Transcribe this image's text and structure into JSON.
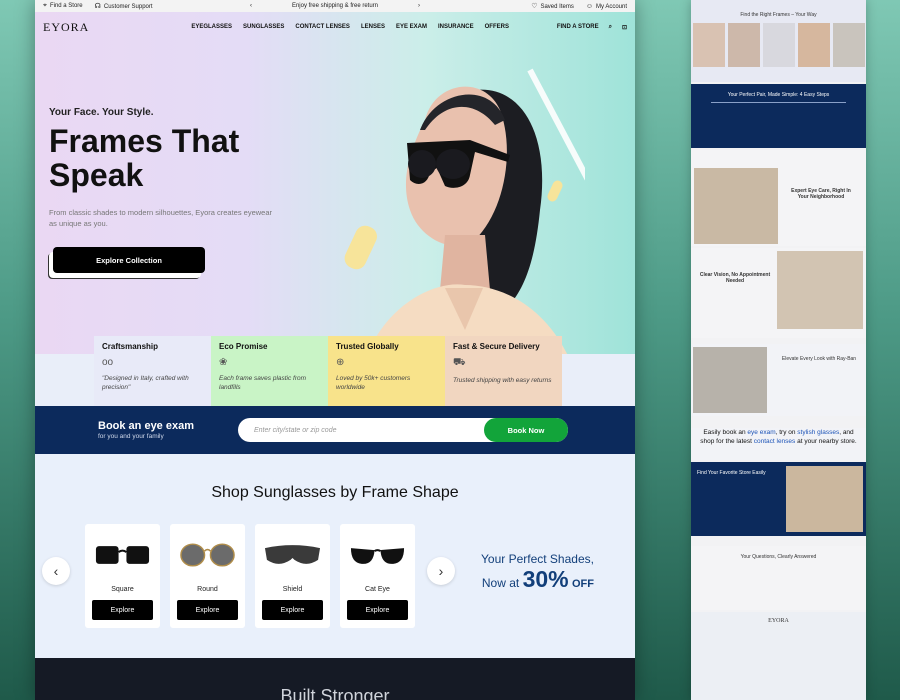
{
  "topbar": {
    "find_store": "Find a Store",
    "support": "Customer Support",
    "promo": "Enjoy free shipping & free return",
    "saved": "Saved Items",
    "account": "My Account"
  },
  "nav": {
    "logo": "EYORA",
    "items": [
      "EYEGLASSES",
      "SUNGLASSES",
      "CONTACT LENSES",
      "LENSES",
      "EYE EXAM",
      "INSURANCE",
      "OFFERS"
    ],
    "find_store": "FIND A STORE"
  },
  "hero": {
    "tagline": "Your Face. Your Style.",
    "headline": "Frames That Speak",
    "sub": "From classic shades to modern silhouettes, Eyora creates eyewear as unique as you.",
    "cta": "Explore Collection"
  },
  "features": [
    {
      "title": "Craftsmanship",
      "text": "\"Designed in Italy, crafted with precision\"",
      "color": "#e8eaf8"
    },
    {
      "title": "Eco Promise",
      "text": "Each frame saves plastic from landfills",
      "color": "#c9f4c6"
    },
    {
      "title": "Trusted Globally",
      "text": "Loved by 50k+ customers worldwide",
      "color": "#f8e38b"
    },
    {
      "title": "Fast & Secure Delivery",
      "text": "Trusted shipping with easy returns",
      "color": "#f1d6c0"
    }
  ],
  "exam": {
    "title": "Book an eye exam",
    "sub": "for you and your family",
    "placeholder": "Enter city/state or zip code",
    "button": "Book Now"
  },
  "shop": {
    "title": "Shop Sunglasses by Frame Shape",
    "cards": [
      {
        "name": "Square",
        "button": "Explore"
      },
      {
        "name": "Round",
        "button": "Explore"
      },
      {
        "name": "Shield",
        "button": "Explore"
      },
      {
        "name": "Cat Eye",
        "button": "Explore"
      }
    ],
    "promo_l1": "Your Perfect Shades,",
    "promo_l2": "Now at",
    "promo_big": "30%",
    "promo_off": "OFF"
  },
  "dark": {
    "title": "Built Stronger"
  },
  "side": {
    "s1": "Find the Right Frames – Your Way",
    "s2": "Your Perfect Pair, Made Simple: 4 Easy Steps",
    "s3": "Expert Eye Care, Right In Your Neighborhood",
    "s4": "Clear Vision, No Appointment Needed",
    "s5": "Elevate Every Look with Ray-Ban",
    "s6a": "Easily book an",
    "s6b": "eye exam",
    "s6c": ", try on",
    "s6d": "stylish glasses",
    "s6e": ", and shop for the latest",
    "s6f": "contact lenses",
    "s6g": "at your nearby store.",
    "s7": "Find Your Favorite Store Easily",
    "s8": "Your Questions, Clearly Answered",
    "logo": "EYORA"
  }
}
